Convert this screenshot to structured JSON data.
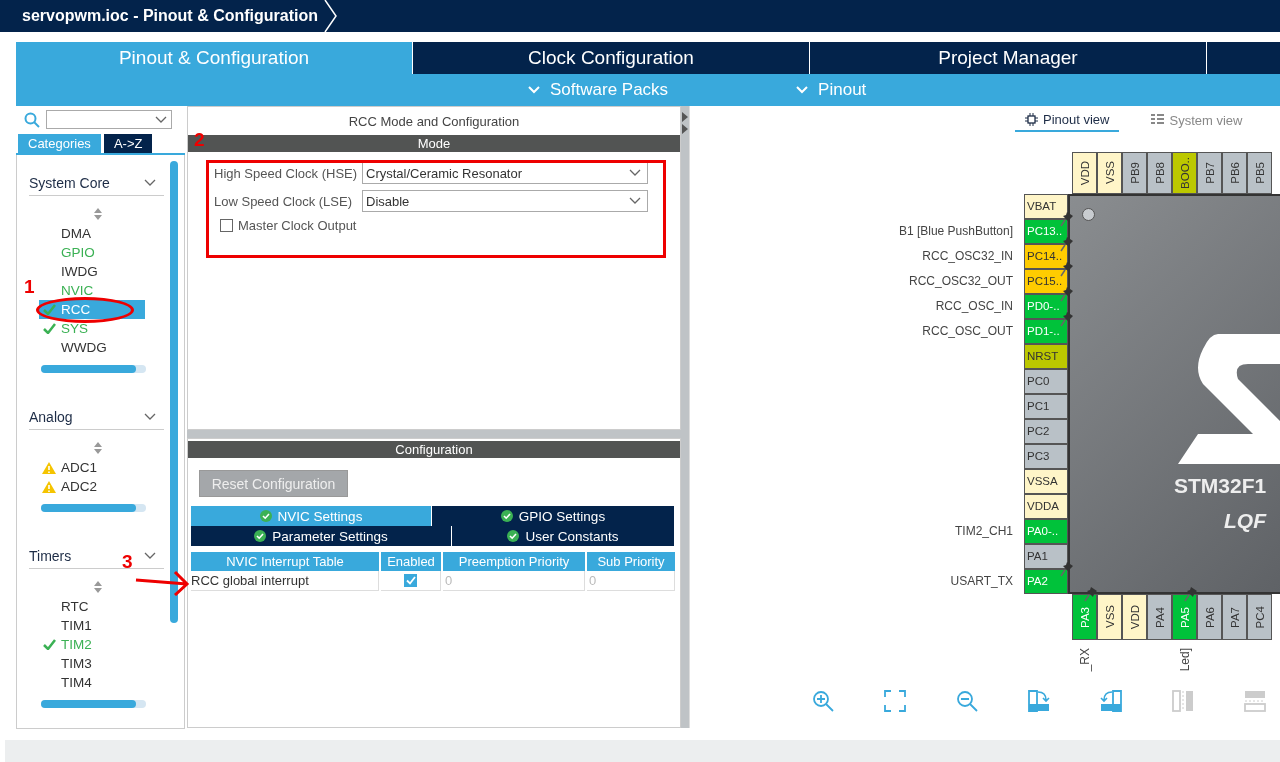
{
  "title": "servopwm.ioc - Pinout & Configuration",
  "main_tabs": [
    {
      "label": "Pinout & Configuration",
      "selected": true
    },
    {
      "label": "Clock Configuration",
      "selected": false
    },
    {
      "label": "Project Manager",
      "selected": false
    }
  ],
  "sub_menu": [
    "Software Packs",
    "Pinout"
  ],
  "sidebar": {
    "category_tabs": [
      {
        "label": "Categories",
        "selected": true
      },
      {
        "label": "A->Z",
        "selected": false
      }
    ],
    "sections": [
      {
        "title": "System Core",
        "items": [
          {
            "label": "DMA",
            "configured": false,
            "checked": false,
            "warning": false,
            "selected": false
          },
          {
            "label": "GPIO",
            "configured": true,
            "checked": false,
            "warning": false,
            "selected": false
          },
          {
            "label": "IWDG",
            "configured": false,
            "checked": false,
            "warning": false,
            "selected": false
          },
          {
            "label": "NVIC",
            "configured": true,
            "checked": false,
            "warning": false,
            "selected": false
          },
          {
            "label": "RCC",
            "configured": true,
            "checked": true,
            "warning": false,
            "selected": true
          },
          {
            "label": "SYS",
            "configured": true,
            "checked": true,
            "warning": false,
            "selected": false
          },
          {
            "label": "WWDG",
            "configured": false,
            "checked": false,
            "warning": false,
            "selected": false
          }
        ]
      },
      {
        "title": "Analog",
        "items": [
          {
            "label": "ADC1",
            "configured": false,
            "checked": false,
            "warning": true,
            "selected": false
          },
          {
            "label": "ADC2",
            "configured": false,
            "checked": false,
            "warning": true,
            "selected": false
          }
        ]
      },
      {
        "title": "Timers",
        "items": [
          {
            "label": "RTC",
            "configured": false,
            "checked": false,
            "warning": false,
            "selected": false
          },
          {
            "label": "TIM1",
            "configured": false,
            "checked": false,
            "warning": false,
            "selected": false
          },
          {
            "label": "TIM2",
            "configured": true,
            "checked": true,
            "warning": false,
            "selected": false
          },
          {
            "label": "TIM3",
            "configured": false,
            "checked": false,
            "warning": false,
            "selected": false
          },
          {
            "label": "TIM4",
            "configured": false,
            "checked": false,
            "warning": false,
            "selected": false
          }
        ]
      }
    ]
  },
  "mode_panel": {
    "title": "RCC Mode and Configuration",
    "header": "Mode",
    "fields": [
      {
        "label": "High Speed Clock (HSE)",
        "value": "Crystal/Ceramic Resonator"
      },
      {
        "label": "Low Speed Clock (LSE)",
        "value": "Disable"
      }
    ],
    "checkbox": {
      "label": "Master Clock Output",
      "checked": false
    }
  },
  "config_panel": {
    "header": "Configuration",
    "reset_button": {
      "label": "Reset Configuration",
      "disabled": true
    },
    "tab_rows": [
      [
        {
          "label": "NVIC Settings",
          "selected": true
        },
        {
          "label": "GPIO Settings",
          "selected": false
        }
      ],
      [
        {
          "label": "Parameter Settings",
          "selected": false
        },
        {
          "label": "User Constants",
          "selected": false
        }
      ]
    ],
    "table": {
      "columns": [
        "NVIC Interrupt Table",
        "Enabled",
        "Preemption Priority",
        "Sub Priority"
      ],
      "rows": [
        {
          "name": "RCC global interrupt",
          "enabled": true,
          "preemption": "0",
          "sub": "0"
        }
      ]
    }
  },
  "view_tabs": [
    {
      "label": "Pinout view",
      "selected": true
    },
    {
      "label": "System view",
      "selected": false
    }
  ],
  "chip": {
    "name": "STM32F1",
    "package": "LQF"
  },
  "pins": {
    "top": [
      {
        "name": "VDD",
        "color": "#fff5c8"
      },
      {
        "name": "VSS",
        "color": "#fff5c8"
      },
      {
        "name": "PB9",
        "color": "#b9c1c7"
      },
      {
        "name": "PB8",
        "color": "#b9c1c7"
      },
      {
        "name": "BOO..",
        "color": "#bcc800"
      },
      {
        "name": "PB7",
        "color": "#b9c1c7"
      },
      {
        "name": "PB6",
        "color": "#b9c1c7"
      },
      {
        "name": "PB5",
        "color": "#b9c1c7"
      }
    ],
    "left": [
      {
        "name": "VBAT",
        "color": "#fff5c8",
        "pinned": false
      },
      {
        "name": "PC13..",
        "color": "#00c23a",
        "pinned": true,
        "label": "B1 [Blue PushButton]"
      },
      {
        "name": "PC14..",
        "color": "#ffcc00",
        "pinned": true,
        "label": "RCC_OSC32_IN"
      },
      {
        "name": "PC15..",
        "color": "#ffcc00",
        "pinned": true,
        "label": "RCC_OSC32_OUT"
      },
      {
        "name": "PD0-..",
        "color": "#00c23a",
        "pinned": true,
        "label": "RCC_OSC_IN"
      },
      {
        "name": "PD1-..",
        "color": "#00c23a",
        "pinned": true,
        "label": "RCC_OSC_OUT"
      },
      {
        "name": "NRST",
        "color": "#bcc800",
        "pinned": false
      },
      {
        "name": "PC0",
        "color": "#b9c1c7",
        "pinned": false
      },
      {
        "name": "PC1",
        "color": "#b9c1c7",
        "pinned": false
      },
      {
        "name": "PC2",
        "color": "#b9c1c7",
        "pinned": false
      },
      {
        "name": "PC3",
        "color": "#b9c1c7",
        "pinned": false
      },
      {
        "name": "VSSA",
        "color": "#fff5c8",
        "pinned": false
      },
      {
        "name": "VDDA",
        "color": "#fff5c8",
        "pinned": false
      },
      {
        "name": "PA0-..",
        "color": "#00c23a",
        "pinned": false,
        "label": "TIM2_CH1"
      },
      {
        "name": "PA1",
        "color": "#b9c1c7",
        "pinned": false
      },
      {
        "name": "PA2",
        "color": "#00c23a",
        "pinned": true,
        "label": "USART_TX"
      }
    ],
    "bottom": [
      {
        "name": "PA3",
        "color": "#00c23a",
        "pinned": true,
        "label": "_RX"
      },
      {
        "name": "VSS",
        "color": "#fff5c8",
        "pinned": false
      },
      {
        "name": "VDD",
        "color": "#fff5c8",
        "pinned": false
      },
      {
        "name": "PA4",
        "color": "#b9c1c7",
        "pinned": false
      },
      {
        "name": "PA5",
        "color": "#00c23a",
        "pinned": true,
        "label": "Led]"
      },
      {
        "name": "PA6",
        "color": "#b9c1c7",
        "pinned": false
      },
      {
        "name": "PA7",
        "color": "#b9c1c7",
        "pinned": false
      },
      {
        "name": "PC4",
        "color": "#b9c1c7",
        "pinned": false
      }
    ]
  },
  "annotations": [
    {
      "kind": "ellipse",
      "label": "1"
    },
    {
      "kind": "rect",
      "label": "2"
    },
    {
      "kind": "arrow",
      "label": "3"
    }
  ]
}
